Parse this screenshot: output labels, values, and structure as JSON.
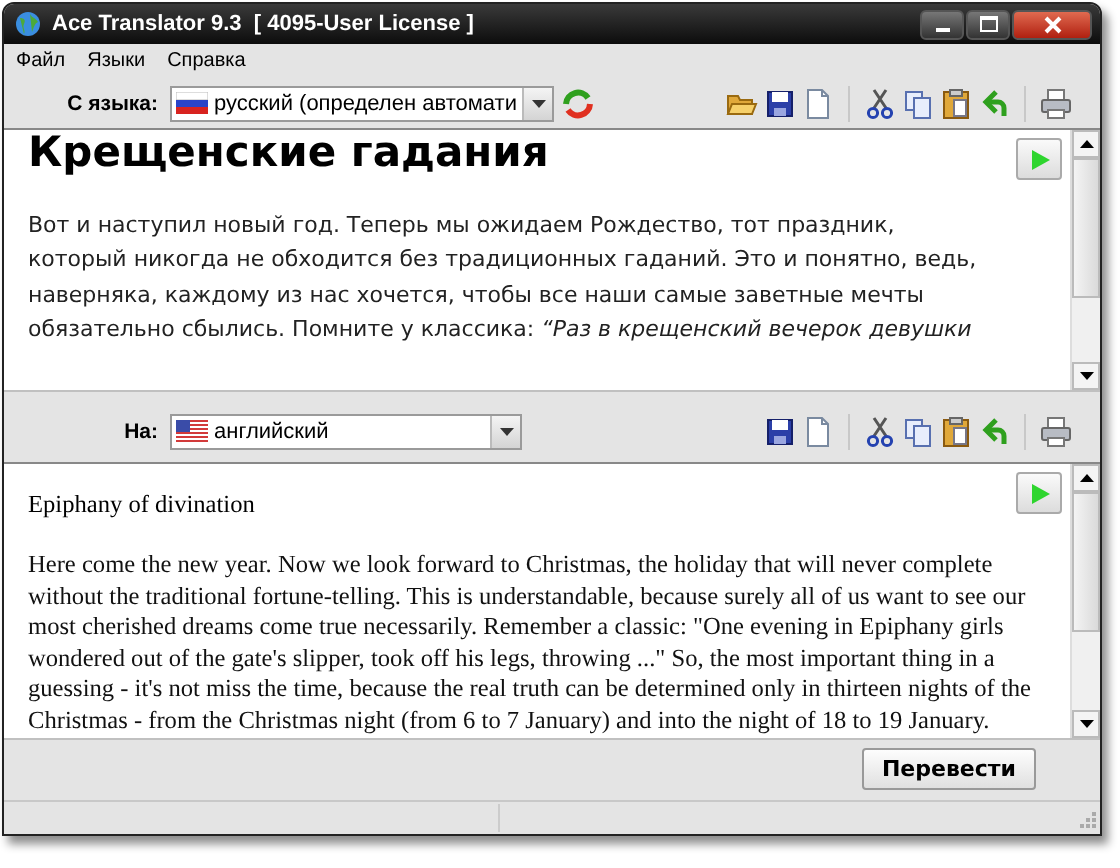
{
  "window": {
    "title": "Ace Translator 9.3  [ 4095-User License ]"
  },
  "menu": [
    "Файл",
    "Языки",
    "Справка"
  ],
  "source": {
    "label": "С языка:",
    "language": "русский (определен автомати",
    "heading": "Крещенские гадания",
    "paragraph": "Вот и наступил новый год. Теперь мы ожидаем Рождество, тот праздник, который никогда не обходится без традиционных гаданий. Это и понятно, ведь, наверняка, каждому из нас хочется, чтобы все наши самые заветные мечты обязательно сбылись. Помните у классика: *“Раз в крещенский вечерок девушки*"
  },
  "target": {
    "label": "На:",
    "language": "английский",
    "heading": "Epiphany of divination",
    "paragraph": "Here come the new year. Now we look forward to Christmas, the holiday that will never complete without the traditional fortune-telling. This is understandable, because surely all of us want to see our most cherished dreams come true necessarily. Remember a classic: \"One evening in Epiphany girls wondered out of the gate's slipper, took off his legs, throwing ...\" So, the most important thing in a guessing - it's not miss the time, because the real truth can be determined only in thirteen nights of the Christmas - from the Christmas night (from 6 to 7 January) and into the night of 18 to 19 January."
  },
  "translate_button": "Перевести"
}
